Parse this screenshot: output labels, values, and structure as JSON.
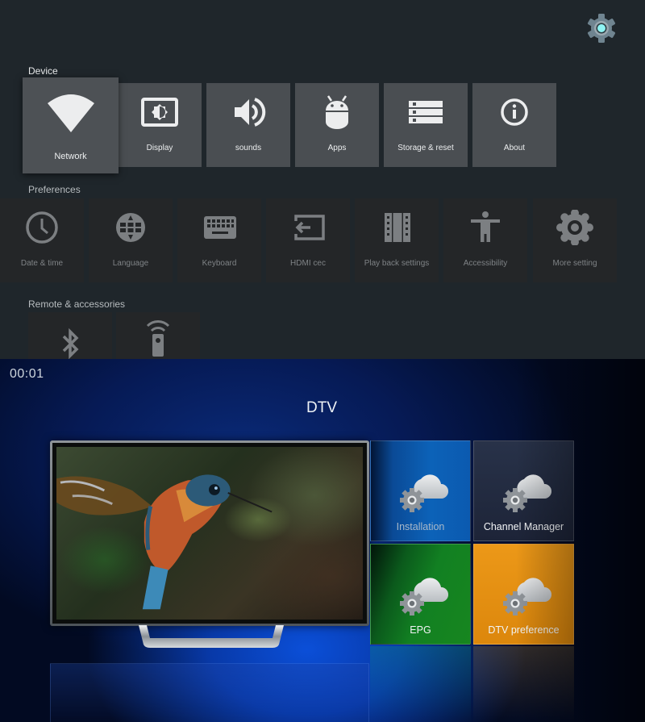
{
  "settings": {
    "top_icon": "settings-gear-icon",
    "sections": {
      "device": {
        "title": "Device",
        "items": [
          {
            "label": "Network",
            "icon": "wifi-icon",
            "focused": true
          },
          {
            "label": "Display",
            "icon": "display-brightness-icon"
          },
          {
            "label": "sounds",
            "icon": "speaker-icon"
          },
          {
            "label": "Apps",
            "icon": "android-icon"
          },
          {
            "label": "Storage & reset",
            "icon": "storage-icon"
          },
          {
            "label": "About",
            "icon": "info-icon"
          }
        ]
      },
      "preferences": {
        "title": "Preferences",
        "items": [
          {
            "label": "Date & time",
            "icon": "clock-icon"
          },
          {
            "label": "Language",
            "icon": "globe-icon"
          },
          {
            "label": "Keyboard",
            "icon": "keyboard-icon"
          },
          {
            "label": "HDMI cec",
            "icon": "input-icon"
          },
          {
            "label": "Play back settings",
            "icon": "film-icon"
          },
          {
            "label": "Accessibility",
            "icon": "accessibility-icon"
          },
          {
            "label": "More setting",
            "icon": "gear-icon"
          }
        ]
      },
      "remote": {
        "title": "Remote & accessories",
        "items": [
          {
            "label": "",
            "icon": "bluetooth-icon"
          },
          {
            "label": "",
            "icon": "remote-icon"
          }
        ]
      }
    }
  },
  "dtv": {
    "clock": "00:01",
    "title": "DTV",
    "preview_image": "hummingbird-video-preview",
    "tiles": [
      {
        "label": "Installation",
        "icon": "cloud-gear-icon",
        "color": "#0c62b8"
      },
      {
        "label": "Channel Manager",
        "icon": "cloud-gear-icon",
        "color": "#252e44"
      },
      {
        "label": "EPG",
        "icon": "cloud-gear-icon",
        "color": "#128022"
      },
      {
        "label": "DTV preference",
        "icon": "cloud-gear-icon",
        "color": "#e8920f"
      }
    ]
  },
  "colors": {
    "settings_bg": "#1f262b",
    "tile_bg": "#4a4e52",
    "tile_dim_bg": "#242628",
    "gear_accent": "#8ff3f3"
  }
}
